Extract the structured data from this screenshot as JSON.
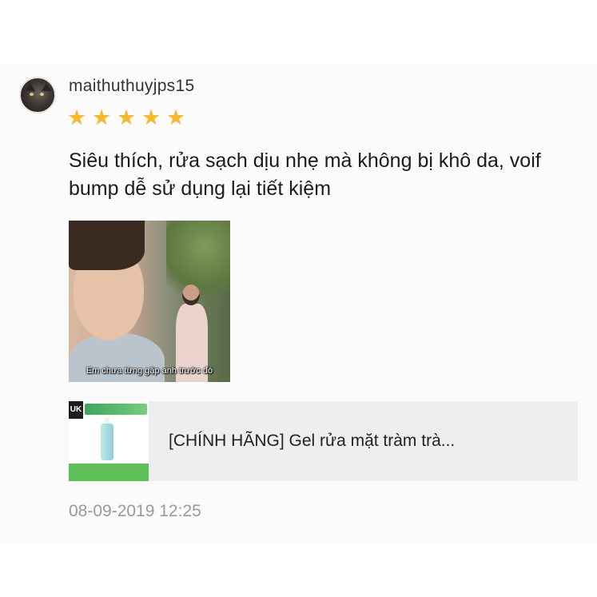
{
  "review": {
    "username": "maithuthuyjps15",
    "rating": 5,
    "rating_max": 5,
    "star_glyph": "★",
    "star_color": "#f7b731",
    "text": "Siêu thích, rửa sạch dịu nhẹ mà không bị khô da, voif bump dễ sử dụng lại tiết kiệm",
    "photo_subtitle": "Em chưa từng gặp anh trước đó",
    "product_title": "[CHÍNH HÃNG] Gel rửa mặt tràm trà...",
    "thumb_logo_text": "UK",
    "timestamp": "08-09-2019 12:25"
  },
  "colors": {
    "text": "#1c1c1c",
    "muted": "#9a9a9a",
    "product_bg": "#eeeeee"
  }
}
